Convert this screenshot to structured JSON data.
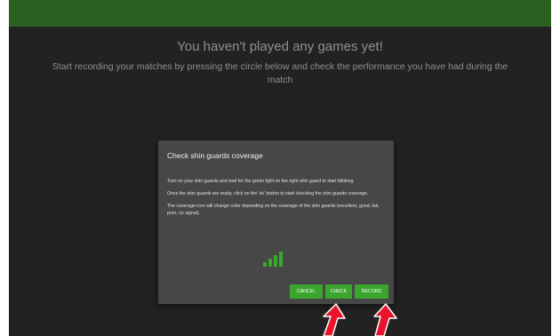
{
  "empty_state": {
    "title": "You haven't played any games yet!",
    "subtitle": "Start recording your matches by pressing the circle below and check the performance you have had during the match"
  },
  "dialog": {
    "title": "Check shin guards coverage",
    "paragraphs": [
      "Turn on your shin guards and wait for the green light on the right shin guard to start blinking.",
      "Once the shin guards are ready, click on the 'ok' button to start checking the shin guards coverage.",
      "The coverage icon will change color depending on the coverage of the shin guards (excellent, good, fair, poor, no signal)."
    ],
    "signal_icon": "signal-bars-icon",
    "signal_color": "#38a82a",
    "buttons": {
      "cancel": "CANCEL",
      "check": "CHECK",
      "record": "RECORD"
    }
  },
  "colors": {
    "topbar": "#2a6020",
    "background": "#222222",
    "dialog": "#474747",
    "accent": "#3aa62e",
    "arrow": "#e8142e"
  }
}
